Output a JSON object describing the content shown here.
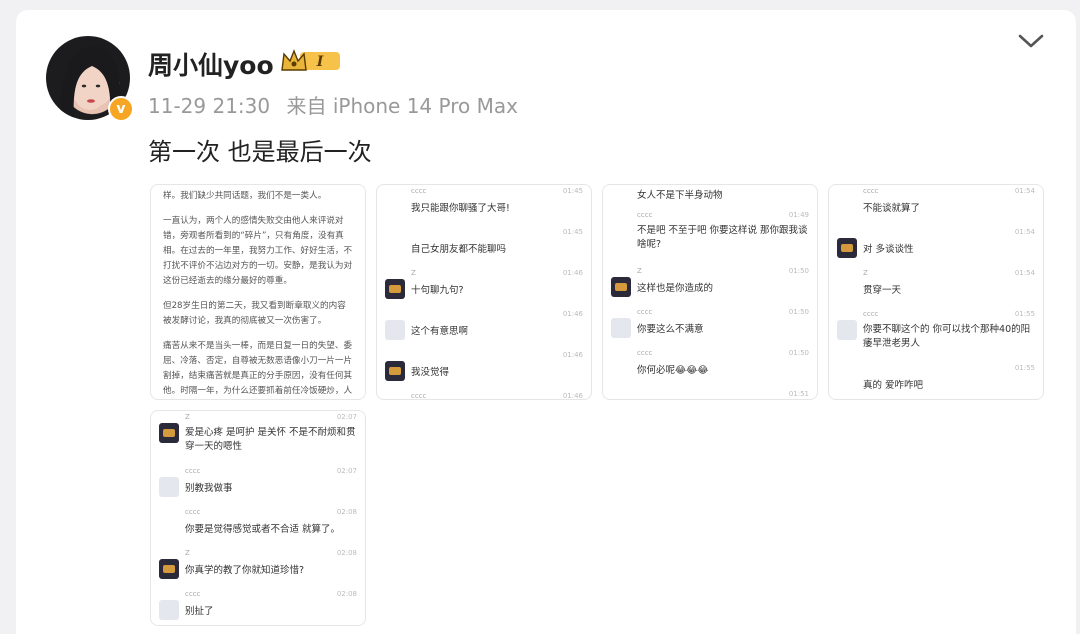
{
  "post": {
    "username": "周小仙yoo",
    "level_badge": "I",
    "date": "11-29 21:30",
    "source": "来自 iPhone 14 Pro Max",
    "text": "第一次 也是最后一次"
  },
  "icons": {
    "verified": "v-badge",
    "more": "chevron-down-icon",
    "crown": "crown-badge"
  },
  "colors": {
    "verified": "#f6a623",
    "crown": "#e8b43a"
  },
  "images": {
    "img1": {
      "paragraphs": [
        "样。我们缺少共同话题，我们不是一类人。",
        "一直认为，两个人的感情失败交由他人来评说对错，旁观者所看到的“碎片”，只有角度，没有真相。在过去的一年里，我努力工作、好好生活，不打扰不评价不沾边对方的一切。安静，是我认为对这份已经逝去的缘分最好的尊重。",
        "但28岁生日的第二天，我又看到断章取义的内容被发酵讨论，我真的彻底被又一次伤害了。",
        "痛苦从来不是当头一棒，而是日复一日的失望、委屈、冷落、否定，自尊被无数恶语像小刀一片一片割掉，结束痛苦就是真正的分手原因，没有任何其他。时隔一年，为什么还要抓着前任冷饭硬炒，人生能不能向前看？"
      ]
    },
    "img2": {
      "messages": [
        {
          "name": "cccc",
          "time": "01:45",
          "text": "我只能跟你聊骚了大哥!"
        },
        {
          "name": "",
          "time": "01:45",
          "text": "自己女朋友都不能聊吗"
        },
        {
          "name": "Z",
          "time": "01:46",
          "text": "十句聊九句?"
        },
        {
          "name": "",
          "time": "01:46",
          "text": "这个有意思啊"
        },
        {
          "name": "",
          "time": "01:46",
          "text": "我没觉得"
        },
        {
          "name": "cccc",
          "time": "01:46",
          "text": ""
        }
      ]
    },
    "img3": {
      "messages": [
        {
          "name": "",
          "time": "",
          "text": "女人不是下半身动物"
        },
        {
          "name": "cccc",
          "time": "01:49",
          "text": "不是吧 不至于吧 你要这样说 那你跟我谈啥呢?"
        },
        {
          "name": "Z",
          "time": "01:50",
          "text": "这样也是你造成的"
        },
        {
          "name": "cccc",
          "time": "01:50",
          "text": "你要这么不满意"
        },
        {
          "name": "cccc",
          "time": "01:50",
          "text": "你何必呢😂😂😂"
        },
        {
          "name": "",
          "time": "01:51",
          "text": ""
        }
      ]
    },
    "img4": {
      "messages": [
        {
          "name": "cccc",
          "time": "01:54",
          "text": "不能谈就算了"
        },
        {
          "name": "",
          "time": "01:54",
          "text": "对 多谈谈性"
        },
        {
          "name": "Z",
          "time": "01:54",
          "text": "贯穿一天"
        },
        {
          "name": "cccc",
          "time": "01:55",
          "text": "你要不聊这个的 你可以找个那种40的阳痿早泄老男人"
        },
        {
          "name": "",
          "time": "01:55",
          "text": "真的 爱咋咋吧"
        }
      ]
    },
    "img5": {
      "messages": [
        {
          "name": "Z",
          "time": "02:07",
          "text": "爱是心疼 是呵护 是关怀 不是不耐烦和贯穿一天的嗯性"
        },
        {
          "name": "cccc",
          "time": "02:07",
          "text": "别教我做事"
        },
        {
          "name": "cccc",
          "time": "02:08",
          "text": "你要是觉得感觉或者不合适 就算了。"
        },
        {
          "name": "Z",
          "time": "02:08",
          "text": "你真学的教了你就知道珍惜?"
        },
        {
          "name": "cccc",
          "time": "02:08",
          "text": "别扯了"
        }
      ]
    }
  }
}
